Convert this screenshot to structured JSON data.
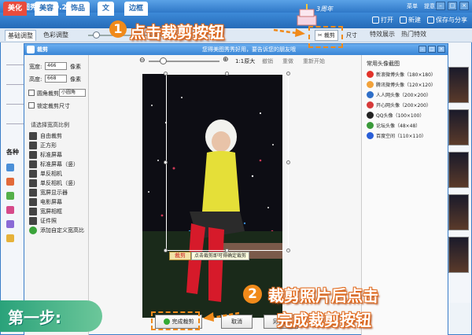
{
  "app": {
    "title": "美图秀秀 3.0.2",
    "logo": "秀",
    "tabs": [
      "美化",
      "美容",
      "饰品",
      "文",
      "边框"
    ],
    "menu": [
      "菜单",
      "提意见"
    ],
    "open_label": "打开",
    "new_label": "新建",
    "save_label": "保存与分享",
    "anniversary_label": "3周年"
  },
  "toolbar": {
    "subtabs": [
      "基础调整",
      "色彩调整"
    ],
    "crop_label": "裁剪",
    "size_label": "尺寸",
    "right_tabs": [
      "特效展示",
      "热门特效"
    ]
  },
  "left_panel": {
    "section_title": "各种"
  },
  "dialog": {
    "title": "裁剪",
    "hint": "您得美图秀秀好用，要告诉您的朋友哦",
    "width_label": "宽度:",
    "width_value": "466",
    "height_label": "高度:",
    "height_value": "668",
    "unit": "像素",
    "round_corner_label": "圆角裁剪",
    "round_corner_option": "小圆角",
    "lock_size_label": "锁定裁剪尺寸",
    "ratio_title": "请选择宽高比例",
    "ratios": [
      "自由裁剪",
      "正方形",
      "标准屏幕",
      "标准屏幕（竖）",
      "单反相机",
      "单反相机（竖）",
      "宽屏显示器",
      "电影屏幕",
      "宽屏相框",
      "证件照",
      "添加自定义宽高比"
    ],
    "tools": [
      "1:1原大",
      "撤销",
      "重做",
      "重新开始"
    ],
    "crop_tag": "裁剪",
    "crop_tip": "点击裁剪即可得确定裁剪",
    "avatar_title": "常用头像截图",
    "avatars": [
      "新浪微博头像（180×180）",
      "腾讯微博头像（120×120）",
      "人人网头像（200×200）",
      "开心网头像（200×200）",
      "QQ头像（100×100）",
      "论坛头像（48×48）",
      "百度空间（110×110）"
    ],
    "done_label": "完成裁剪",
    "cancel_label": "取消",
    "saveas_label": "另存为"
  },
  "annotations": {
    "step1_number": "1",
    "step1_text": "点击裁剪按钮",
    "step2_number": "2",
    "step2_line1": "裁剪照片后点击",
    "step2_line2": "完成裁剪按钮",
    "step_badge": "第一步:"
  },
  "colors": {
    "accent_orange": "#f08a1a",
    "title_blue": "#3b7ec9",
    "tab_red": "#e94c3d",
    "badge_green": "#2aa27a"
  }
}
